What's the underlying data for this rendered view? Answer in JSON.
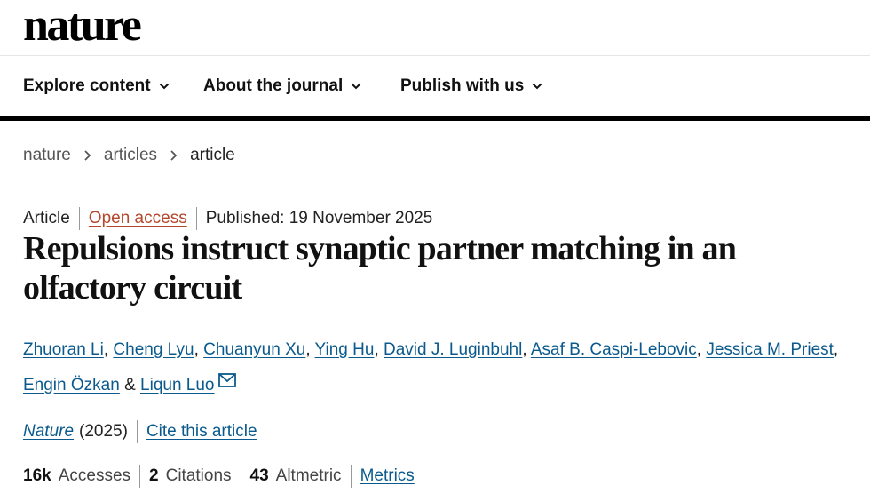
{
  "site": {
    "logo": "nature"
  },
  "nav": {
    "items": [
      {
        "label": "Explore content"
      },
      {
        "label": "About the journal"
      },
      {
        "label": "Publish with us"
      }
    ]
  },
  "breadcrumb": {
    "items": [
      "nature",
      "articles",
      "article"
    ]
  },
  "article": {
    "type": "Article",
    "access": "Open access",
    "published": "Published: 19 November 2025",
    "title": "Repulsions instruct synaptic partner matching in an olfactory circuit",
    "authors": [
      "Zhuoran Li",
      "Cheng Lyu",
      "Chuanyun Xu",
      "Ying Hu",
      "David J. Luginbuhl",
      "Asaf B. Caspi-Lebovic",
      "Jessica M. Priest",
      "Engin Özkan",
      "Liqun Luo"
    ],
    "author_separator": ", ",
    "author_last_separator": " & ",
    "journal": "Nature",
    "year": "(2025)",
    "cite_label": "Cite this article"
  },
  "metrics": {
    "accesses_value": "16k",
    "accesses_label": "Accesses",
    "citations_value": "2",
    "citations_label": "Citations",
    "altmetric_value": "43",
    "altmetric_label": "Altmetric",
    "metrics_link": "Metrics"
  },
  "colors": {
    "link": "#0b5a8d",
    "open_access": "#b5472c",
    "text": "#222222"
  },
  "icons": {
    "nav_chevron": "chevron-down-icon",
    "breadcrumb_sep": "chevron-right-icon",
    "corresponding": "mail-icon"
  }
}
